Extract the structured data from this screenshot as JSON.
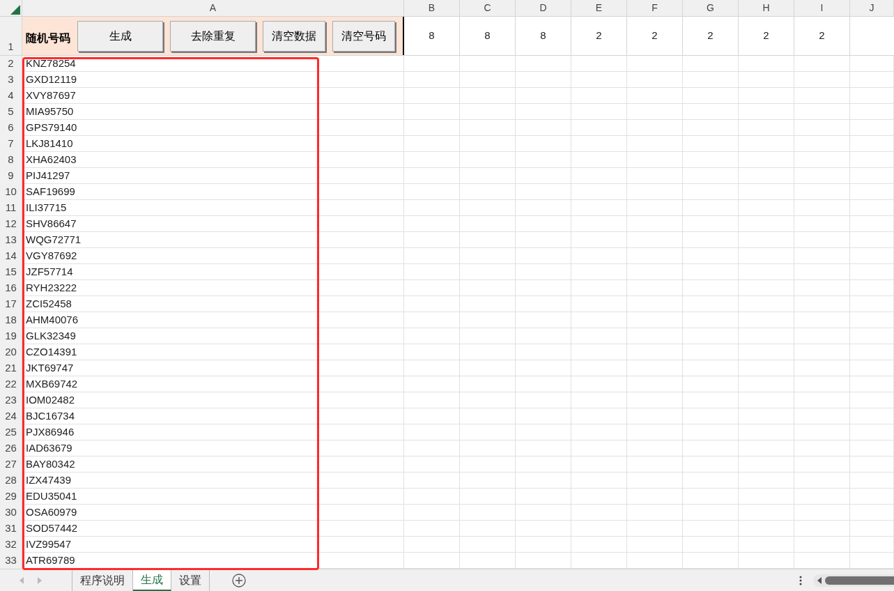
{
  "column_headers": [
    "A",
    "B",
    "C",
    "D",
    "E",
    "F",
    "G",
    "H",
    "I",
    "J"
  ],
  "header_row": {
    "row_number": "1",
    "label": "随机号码",
    "buttons": [
      "生成",
      "去除重复",
      "清空数据",
      "清空号码"
    ],
    "values": [
      "8",
      "8",
      "8",
      "2",
      "2",
      "2",
      "2",
      "2"
    ]
  },
  "rows": [
    {
      "row_number": "2",
      "code": "KNZ78254"
    },
    {
      "row_number": "3",
      "code": "GXD12119"
    },
    {
      "row_number": "4",
      "code": "XVY87697"
    },
    {
      "row_number": "5",
      "code": "MIA95750"
    },
    {
      "row_number": "6",
      "code": "GPS79140"
    },
    {
      "row_number": "7",
      "code": "LKJ81410"
    },
    {
      "row_number": "8",
      "code": "XHA62403"
    },
    {
      "row_number": "9",
      "code": "PIJ41297"
    },
    {
      "row_number": "10",
      "code": "SAF19699"
    },
    {
      "row_number": "11",
      "code": "ILI37715"
    },
    {
      "row_number": "12",
      "code": "SHV86647"
    },
    {
      "row_number": "13",
      "code": "WQG72771"
    },
    {
      "row_number": "14",
      "code": "VGY87692"
    },
    {
      "row_number": "15",
      "code": "JZF57714"
    },
    {
      "row_number": "16",
      "code": "RYH23222"
    },
    {
      "row_number": "17",
      "code": "ZCI52458"
    },
    {
      "row_number": "18",
      "code": "AHM40076"
    },
    {
      "row_number": "19",
      "code": "GLK32349"
    },
    {
      "row_number": "20",
      "code": "CZO14391"
    },
    {
      "row_number": "21",
      "code": "JKT69747"
    },
    {
      "row_number": "22",
      "code": "MXB69742"
    },
    {
      "row_number": "23",
      "code": "IOM02482"
    },
    {
      "row_number": "24",
      "code": "BJC16734"
    },
    {
      "row_number": "25",
      "code": "PJX86946"
    },
    {
      "row_number": "26",
      "code": "IAD63679"
    },
    {
      "row_number": "27",
      "code": "BAY80342"
    },
    {
      "row_number": "28",
      "code": "IZX47439"
    },
    {
      "row_number": "29",
      "code": "EDU35041"
    },
    {
      "row_number": "30",
      "code": "OSA60979"
    },
    {
      "row_number": "31",
      "code": "SOD57442"
    },
    {
      "row_number": "32",
      "code": "IVZ99547"
    },
    {
      "row_number": "33",
      "code": "ATR69789"
    }
  ],
  "codes_highlighted": true,
  "sheet_tabs": [
    {
      "label": "程序说明",
      "selected": false
    },
    {
      "label": "生成",
      "selected": true
    },
    {
      "label": "设置",
      "selected": false
    }
  ]
}
